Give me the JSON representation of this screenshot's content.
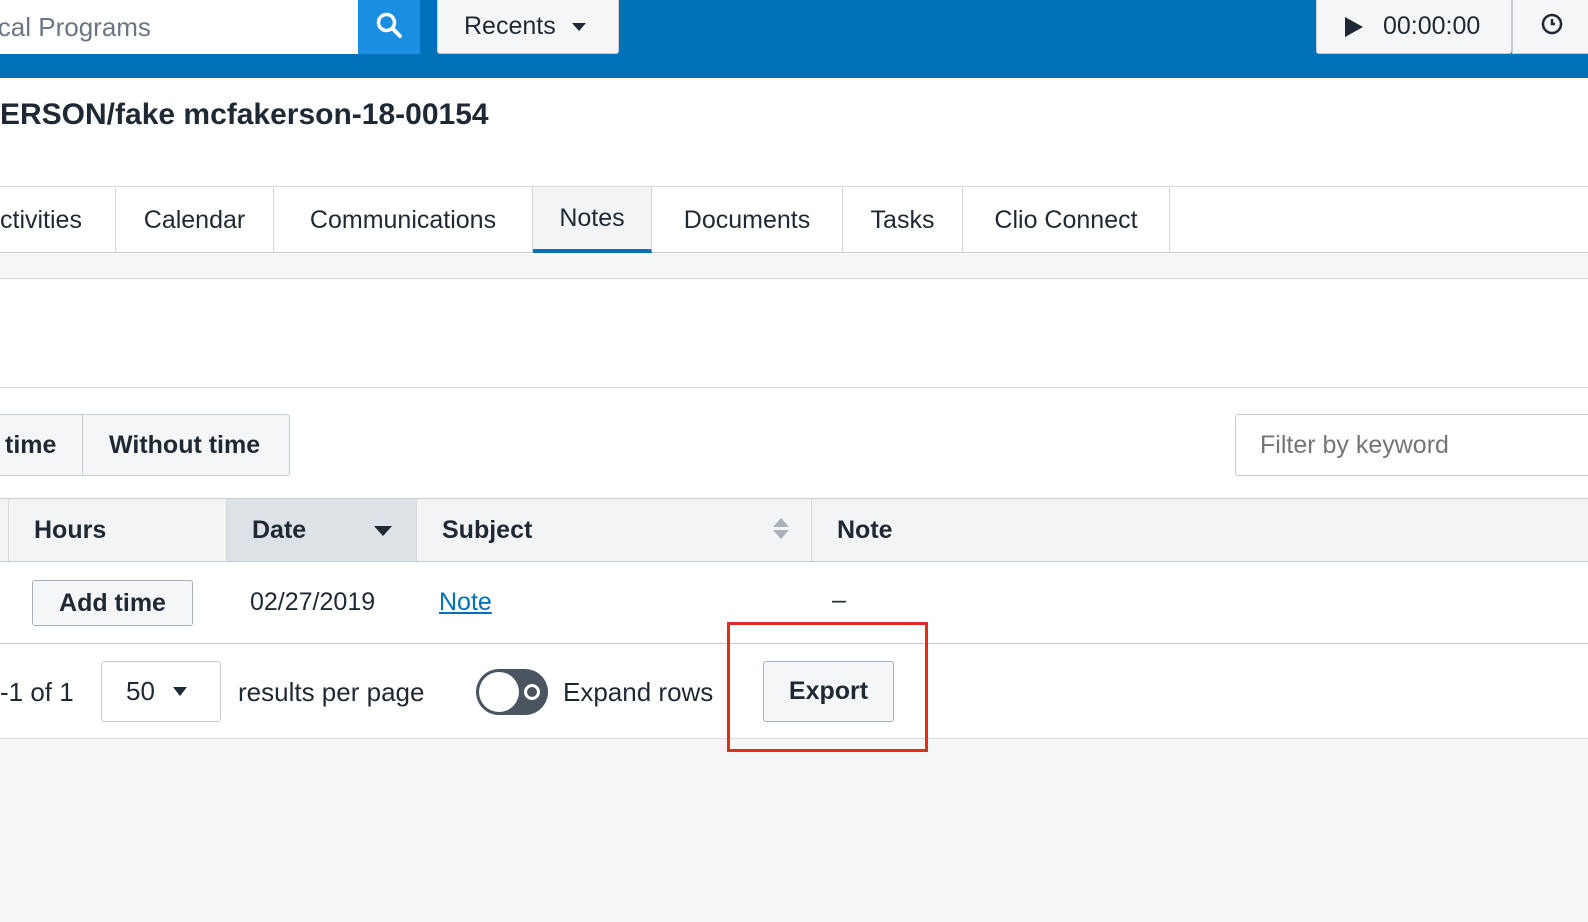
{
  "topbar": {
    "search_value": "ical Programs",
    "search_icon": "search-icon",
    "recents_label": "Recents",
    "timer_value": "00:00:00",
    "clock_icon": "clock-icon",
    "accent_color": "#0070b8"
  },
  "page": {
    "title": "ERSON/fake mcfakerson-18-00154"
  },
  "tabs": [
    {
      "label": "ctivities"
    },
    {
      "label": "Calendar"
    },
    {
      "label": "Communications"
    },
    {
      "label": "Notes",
      "active": true
    },
    {
      "label": "Documents"
    },
    {
      "label": "Tasks"
    },
    {
      "label": "Clio Connect"
    }
  ],
  "filters": {
    "segment_with_time": "time",
    "segment_without_time": "Without time",
    "keyword_placeholder": "Filter by keyword"
  },
  "table": {
    "columns": [
      "Hours",
      "Date",
      "Subject",
      "Note"
    ],
    "sorted_column": "Date",
    "rows": [
      {
        "hours_button": "Add time",
        "date": "02/27/2019",
        "subject": "Note",
        "note": "–"
      }
    ]
  },
  "footer": {
    "range_text": "-1 of 1",
    "per_page_value": "50",
    "per_page_label": "results per page",
    "expand_label": "Expand rows",
    "expand_rows_on": false,
    "export_label": "Export"
  },
  "highlight_color": "#e32b23"
}
